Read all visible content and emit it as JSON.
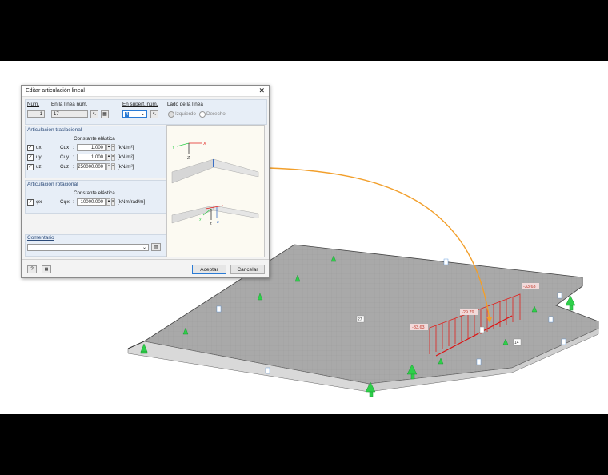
{
  "dialog": {
    "title": "Editar articulación lineal",
    "num_label": "Núm.",
    "num_value": "1",
    "line_label": "En la línea núm.",
    "line_value": "17",
    "surface_label": "En superf. núm.",
    "surface_value": "4",
    "side_label": "Lado de la línea",
    "side_left": "Izquierdo",
    "side_right": "Derecho",
    "trans_header": "Articulación traslacional",
    "spring_header": "Constante elástica",
    "rows": [
      {
        "dof": "ux",
        "coef": "Cux",
        "value": "1.000",
        "unit": "[kN/m²]"
      },
      {
        "dof": "uy",
        "coef": "Cuy",
        "value": "1.000",
        "unit": "[kN/m²]"
      },
      {
        "dof": "uz",
        "coef": "Cuz",
        "value": "250000.000",
        "unit": "[kN/m²]"
      }
    ],
    "rot_header": "Articulación rotacional",
    "rot_row": {
      "dof": "φx",
      "coef": "Cφx",
      "value": "10000.000",
      "unit": "[kNm/rad/m]"
    },
    "comment_label": "Comentario",
    "ok_label": "Aceptar",
    "cancel_label": "Cancelar"
  },
  "viewport": {
    "labels": {
      "v1": "-33.63",
      "v2": "-29.79",
      "v3": "-33.63"
    },
    "surface_ids": {
      "s1": "27",
      "s2": "14",
      "n1": "4",
      "n2": "6",
      "n3": "5"
    },
    "colors": {
      "accent": "#2a7bd5",
      "load": "#e1201c",
      "support": "#2ecf4a",
      "arrow": "#f29f2b"
    }
  }
}
